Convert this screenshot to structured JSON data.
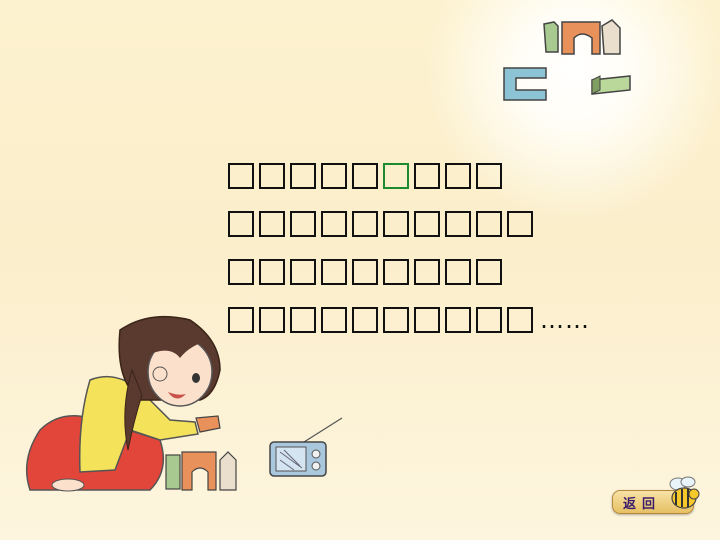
{
  "poem": {
    "lines": [
      {
        "boxes": 5,
        "highlight_box": 1,
        "boxes_after": 3,
        "suffix": ""
      },
      {
        "boxes": 10,
        "highlight_box": 0,
        "boxes_after": 0,
        "suffix": ""
      },
      {
        "boxes": 9,
        "highlight_box": 0,
        "boxes_after": 0,
        "suffix": ""
      },
      {
        "boxes": 10,
        "highlight_box": 0,
        "boxes_after": 0,
        "suffix": "……"
      }
    ]
  },
  "nav": {
    "return_label": "返回"
  },
  "colors": {
    "highlight": "#1e8a2f",
    "button_text": "#3b1d6b"
  },
  "icons": [
    "toy-blocks-icon",
    "girl-illustration",
    "radio-icon",
    "bee-icon"
  ]
}
